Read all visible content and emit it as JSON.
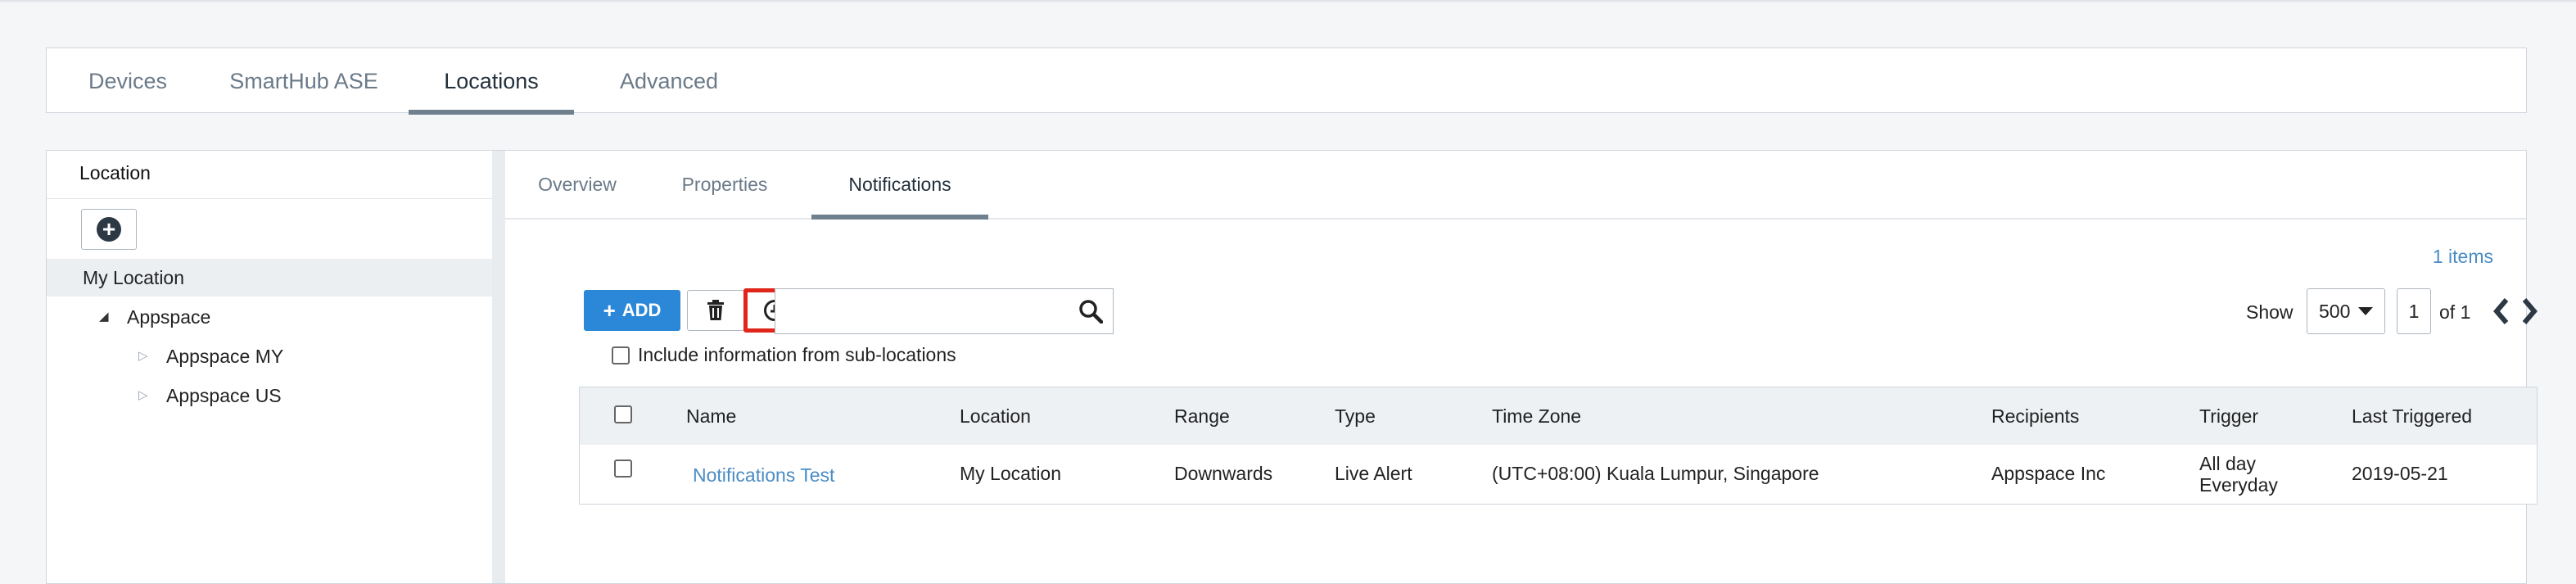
{
  "main_tabs": [
    {
      "label": "Devices"
    },
    {
      "label": "SmartHub ASE"
    },
    {
      "label": "Locations"
    },
    {
      "label": "Advanced"
    }
  ],
  "tree": {
    "title": "Location",
    "items": [
      {
        "label": "My Location"
      },
      {
        "label": "Appspace"
      },
      {
        "label": "Appspace MY"
      },
      {
        "label": "Appspace US"
      }
    ]
  },
  "sub_tabs": [
    {
      "label": "Overview"
    },
    {
      "label": "Properties"
    },
    {
      "label": "Notifications"
    }
  ],
  "toolbar": {
    "add_label": "ADD",
    "search_placeholder": "",
    "include_label": "Include information from sub-locations"
  },
  "pagination": {
    "items_count": "1 items",
    "show_label": "Show",
    "page_size": "500",
    "page": "1",
    "of_label": "of 1"
  },
  "table": {
    "headers": [
      "Name",
      "Location",
      "Range",
      "Type",
      "Time Zone",
      "Recipients",
      "Trigger",
      "Last Triggered"
    ],
    "rows": [
      {
        "name": "Notifications Test",
        "location": "My Location",
        "range": "Downwards",
        "type": "Live Alert",
        "time_zone": "(UTC+08:00) Kuala Lumpur, Singapore",
        "recipients": "Appspace Inc",
        "trigger_line1": "All day",
        "trigger_line2": "Everyday",
        "last_triggered": "2019-05-21"
      }
    ]
  },
  "colors": {
    "accent": "#2b87d8",
    "link": "#4a8cc4",
    "highlight": "#e0251b",
    "tab_underline": "#6f808f"
  },
  "icons": [
    "plus-circle-icon",
    "plus-icon",
    "trash-icon",
    "clock-icon",
    "search-icon",
    "chevron-left-icon",
    "chevron-right-icon",
    "caret-down-icon",
    "tree-expanded-icon",
    "tree-collapsed-icon"
  ]
}
